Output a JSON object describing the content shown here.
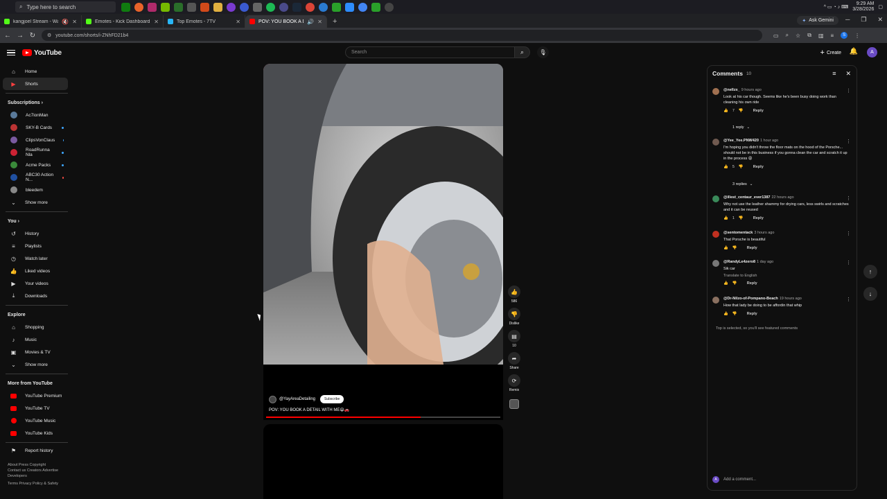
{
  "taskbar": {
    "search_placeholder": "Type here to search",
    "time": "9:29 AM",
    "date": "3/28/2026"
  },
  "browser": {
    "tabs": [
      {
        "title": "kangjoel Stream - Watch Li",
        "color": "#53fc18"
      },
      {
        "title": "Emotes - Kick Dashboard",
        "color": "#53fc18"
      },
      {
        "title": "Top Emotes - 7TV",
        "color": "#29b6f6"
      },
      {
        "title": "POV: YOU BOOK A DETAIL",
        "color": "#ff0000"
      }
    ],
    "new_tab": "+",
    "ask_gemini": "Ask Gemini",
    "url": "youtube.com/shorts/i-ZNhFD21b4"
  },
  "youtube": {
    "logo": "YouTube",
    "search_placeholder": "Search",
    "create_label": "Create",
    "account_initial": "A"
  },
  "sidebar": {
    "main": [
      {
        "label": "Home",
        "icon": "home-icon",
        "glyph": "⌂"
      },
      {
        "label": "Shorts",
        "icon": "shorts-icon",
        "glyph": "▶"
      }
    ],
    "subscriptions_header": "Subscriptions",
    "subscriptions": [
      {
        "label": "Ac7ionMan",
        "color": "#5a7a9a",
        "live": false
      },
      {
        "label": "SKY-B Cards",
        "color": "#b33",
        "live": true
      },
      {
        "label": "ClipsVonClaus",
        "color": "#7a5aa0",
        "live": true
      },
      {
        "label": "RoadRunna Nla",
        "color": "#c23",
        "live": true
      },
      {
        "label": "Acme Packs",
        "color": "#3a8a3a",
        "live": true
      },
      {
        "label": "ABC30 Action N...",
        "color": "#2050a0",
        "live": "red"
      },
      {
        "label": "bleedem",
        "color": "#888",
        "live": false
      }
    ],
    "show_more": "Show more",
    "you_header": "You",
    "you": [
      {
        "label": "History",
        "icon": "history-icon",
        "glyph": "↺"
      },
      {
        "label": "Playlists",
        "icon": "playlists-icon",
        "glyph": "≡"
      },
      {
        "label": "Watch later",
        "icon": "watch-later-icon",
        "glyph": "◷"
      },
      {
        "label": "Liked videos",
        "icon": "liked-videos-icon",
        "glyph": "👍"
      },
      {
        "label": "Your videos",
        "icon": "your-videos-icon",
        "glyph": "▶"
      },
      {
        "label": "Downloads",
        "icon": "downloads-icon",
        "glyph": "⤓"
      }
    ],
    "explore_header": "Explore",
    "explore": [
      {
        "label": "Shopping",
        "icon": "shopping-icon",
        "glyph": "🛍"
      },
      {
        "label": "Music",
        "icon": "music-icon",
        "glyph": "♪"
      },
      {
        "label": "Movies & TV",
        "icon": "movies-icon",
        "glyph": "🎞"
      }
    ],
    "show_more_2": "Show more",
    "more_header": "More from YouTube",
    "more": [
      {
        "label": "YouTube Premium"
      },
      {
        "label": "YouTube TV"
      },
      {
        "label": "YouTube Music"
      },
      {
        "label": "YouTube Kids"
      }
    ],
    "report_history": "Report history",
    "footer_1": "About  Press  Copyright",
    "footer_2": "Contact us  Creators  Advertise",
    "footer_3": "Developers",
    "footer_4": "Terms  Privacy  Policy & Safety"
  },
  "short": {
    "channel": "@YayAreaDetailing",
    "subscribe": "Subscribe",
    "title": "POV: YOU BOOK A DETAIL WITH ME😄🚗",
    "progress": 0.66,
    "actions": [
      {
        "name": "like-button",
        "icon": "thumbs-up-icon",
        "glyph": "👍",
        "label": "586"
      },
      {
        "name": "dislike-button",
        "icon": "thumbs-down-icon",
        "glyph": "👎",
        "label": "Dislike"
      },
      {
        "name": "comments-button",
        "icon": "comment-icon",
        "glyph": "▤",
        "label": "10"
      },
      {
        "name": "share-button",
        "icon": "share-icon",
        "glyph": "➦",
        "label": "Share"
      },
      {
        "name": "remix-button",
        "icon": "remix-icon",
        "glyph": "⟳",
        "label": "Remix"
      }
    ]
  },
  "comments": {
    "title": "Comments",
    "count": "10",
    "items": [
      {
        "author": "@nellzx_",
        "time": "9 hours ago",
        "text": "Look at his car though. Seems like he's been busy doing work than cleaning his own ride",
        "likes": "7",
        "reply": "Reply",
        "color": "#a07050",
        "replies": "1 reply"
      },
      {
        "author": "@Yee_Yee.PNW420",
        "time": "1 hour ago",
        "text": "I'm hoping you didn't throw the floor mats on the hood of the Porsche... should not be in this business if you gonna clean the car and scratch it up in the process 😩",
        "likes": "5",
        "reply": "Reply",
        "color": "#705a50",
        "replies": "3 replies"
      },
      {
        "author": "@illest_centaur_ever1387",
        "time": "22 hours ago",
        "text": "Why not use the leather shammy for drying cars, less swirls and scratches and it can be reused",
        "likes": "1",
        "reply": "Reply",
        "color": "#3a8a5a",
        "replies": ""
      },
      {
        "author": "@sentomentack",
        "time": "3 hours ago",
        "text": "That Porsche is beautiful",
        "likes": "",
        "reply": "Reply",
        "color": "#c03020",
        "replies": ""
      },
      {
        "author": "@RandyLe4zero8",
        "time": "1 day ago",
        "text": "Sik car",
        "translate": "Translate to English",
        "likes": "",
        "reply": "Reply",
        "color": "#777",
        "replies": ""
      },
      {
        "author": "@Dr-Nilzo-of-Pompano-Beach",
        "time": "19 hours ago",
        "text": "How that lady be doing to be affordin that whip",
        "likes": "",
        "reply": "Reply",
        "color": "#8a7060",
        "replies": ""
      }
    ],
    "note": "Top is selected, so you'll see featured comments",
    "add_placeholder": "Add a comment..."
  }
}
